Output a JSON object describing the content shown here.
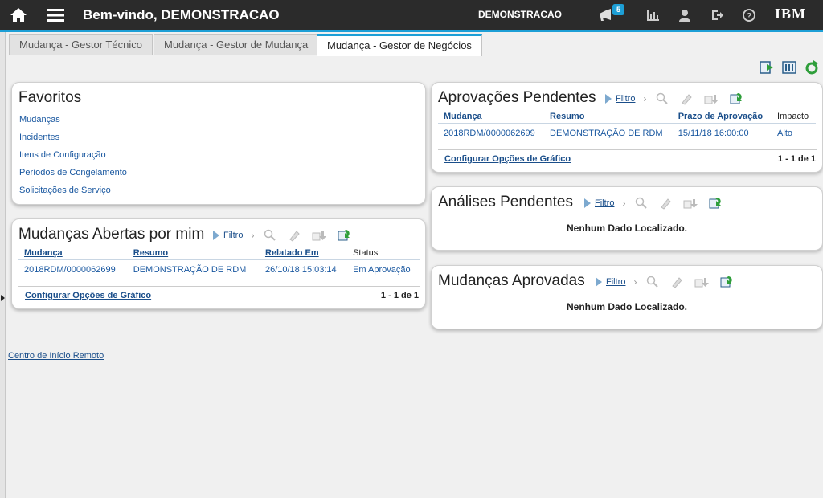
{
  "header": {
    "welcome": "Bem-vindo, DEMONSTRACAO",
    "username": "DEMONSTRACAO",
    "notification_count": "5",
    "logo": "IBM"
  },
  "tabs": [
    {
      "label": "Mudança - Gestor Técnico",
      "active": false
    },
    {
      "label": "Mudança - Gestor de Mudança",
      "active": false
    },
    {
      "label": "Mudança - Gestor de Negócios",
      "active": true
    }
  ],
  "favorites": {
    "title": "Favoritos",
    "items": [
      "Mudanças",
      "Incidentes",
      "Itens de Configuração",
      "Períodos de Congelamento",
      "Solicitações de Serviço"
    ]
  },
  "tools": {
    "filter_label": "Filtro"
  },
  "open_changes": {
    "title": "Mudanças Abertas por mim",
    "columns": [
      "Mudança",
      "Resumo",
      "Relatado Em",
      "Status"
    ],
    "rows": [
      [
        "2018RDM/0000062699",
        "DEMONSTRAÇÃO DE RDM",
        "26/10/18 15:03:14",
        "Em Aprovação"
      ]
    ],
    "config_label": "Configurar Opções de Gráfico",
    "pager": "1 - 1 de 1"
  },
  "pending_approvals": {
    "title": "Aprovações Pendentes",
    "columns": [
      "Mudança",
      "Resumo",
      "Prazo de Aprovação",
      "Impacto"
    ],
    "rows": [
      [
        "2018RDM/0000062699",
        "DEMONSTRAÇÃO DE RDM",
        "15/11/18 16:00:00",
        "Alto"
      ]
    ],
    "config_label": "Configurar Opções de Gráfico",
    "pager": "1 - 1 de 1"
  },
  "pending_reviews": {
    "title": "Análises Pendentes",
    "empty": "Nenhum Dado Localizado."
  },
  "approved_changes": {
    "title": "Mudanças Aprovadas",
    "empty": "Nenhum Dado Localizado."
  },
  "remote_link": "Centro de Início Remoto",
  "colors": {
    "header_bg": "#2b2b2b",
    "accent": "#1d9fd6",
    "link": "#1a58a0"
  }
}
